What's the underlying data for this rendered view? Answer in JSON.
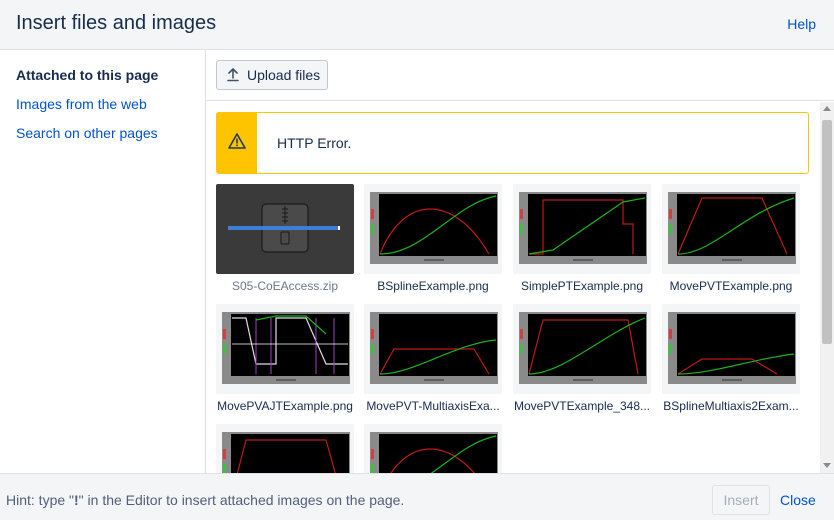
{
  "header": {
    "title": "Insert files and images",
    "help": "Help"
  },
  "sidebar": {
    "items": [
      {
        "label": "Attached to this page",
        "active": true
      },
      {
        "label": "Images from the web",
        "active": false
      },
      {
        "label": "Search on other pages",
        "active": false
      }
    ]
  },
  "toolbar": {
    "upload_label": "Upload files",
    "upload_icon": "upload-icon"
  },
  "error": {
    "message": "HTTP Error.",
    "icon": "warning-icon",
    "color": "#ffc400"
  },
  "files": [
    {
      "name": "S05-CoEAccess.zip",
      "kind": "zip"
    },
    {
      "name": "BSplineExample.png",
      "kind": "plot"
    },
    {
      "name": "SimplePTExample.png",
      "kind": "plot"
    },
    {
      "name": "MovePVTExample.png",
      "kind": "plot"
    },
    {
      "name": "MovePVAJTExample.png",
      "kind": "plot"
    },
    {
      "name": "MovePVT-MultiaxisExa...",
      "kind": "plot"
    },
    {
      "name": "MovePVTExample_348...",
      "kind": "plot"
    },
    {
      "name": "BSplineMultiaxis2Exam...",
      "kind": "plot"
    },
    {
      "name": "",
      "kind": "plot"
    },
    {
      "name": "",
      "kind": "plot"
    }
  ],
  "footer": {
    "hint_prefix": "Hint: type \"",
    "hint_bang": "!",
    "hint_suffix": "\" in the Editor to insert attached images on the page.",
    "insert_label": "Insert",
    "close_label": "Close"
  },
  "colors": {
    "link": "#0052cc",
    "warning": "#ffc400",
    "plot_bg": "#000000",
    "plot_frame": "#8a8a8a",
    "curve_red": "#c01818",
    "curve_green": "#18b418"
  }
}
